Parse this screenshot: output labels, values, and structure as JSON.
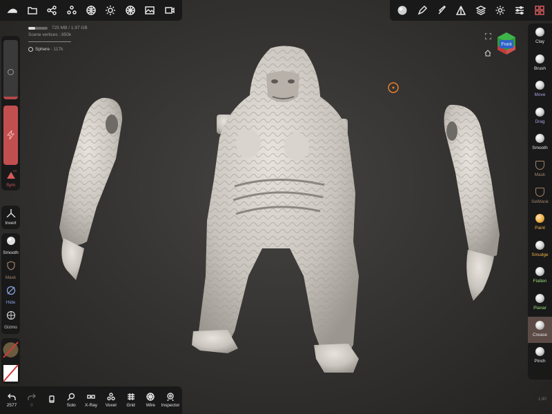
{
  "top_left_toolbar": {
    "icons": [
      "logo-icon",
      "folder-icon",
      "share-nodes-icon",
      "scene-objects-icon",
      "globe-icon",
      "sun-icon",
      "material-icon",
      "image-icon",
      "video-camera-icon"
    ]
  },
  "top_right_toolbar": {
    "icons": [
      "matcap-sphere-icon",
      "pen-icon",
      "brush-icon",
      "symmetry-triangle-icon",
      "layers-icon",
      "gear-icon",
      "sliders-icon",
      "grid-apps-icon"
    ]
  },
  "stats": {
    "memory": "725 MB / 1.97 GB",
    "memory_fraction": 0.37,
    "scene_vertices": "Scene vertices : 850k"
  },
  "object": {
    "name": "Sphere",
    "count": "- 117k"
  },
  "left_panel": {
    "radius_fill_fraction": 0.05,
    "sym_label": "Sym",
    "sym_small": "LR",
    "invert_label": "Invert",
    "tools": [
      {
        "label": "Smooth"
      },
      {
        "label": "Mask"
      },
      {
        "label": "Hide"
      },
      {
        "label": "Gizmo"
      }
    ]
  },
  "bottom_bar": {
    "items": [
      {
        "label": "2577",
        "icon": "undo-icon"
      },
      {
        "label": "0",
        "icon": "redo-icon"
      },
      {
        "label": "",
        "icon": "device-icon"
      },
      {
        "label": "Solo",
        "icon": "search-icon"
      },
      {
        "label": "X-Ray",
        "icon": "glasses-icon"
      },
      {
        "label": "Voxel",
        "icon": "voxel-icon"
      },
      {
        "label": "Grid",
        "icon": "grid-icon"
      },
      {
        "label": "Wire",
        "icon": "wire-icon"
      },
      {
        "label": "Inspector",
        "icon": "inspector-icon"
      }
    ]
  },
  "right_tools": [
    {
      "label": "Clay",
      "color": "#e6e6e6"
    },
    {
      "label": "Brush",
      "color": "#e6e6e6"
    },
    {
      "label": "Move",
      "color": "#a8a3e8"
    },
    {
      "label": "Drag",
      "color": "#a8a3e8"
    },
    {
      "label": "Smooth",
      "color": "#e6e6e6"
    },
    {
      "label": "Mask",
      "color": "#a1836b"
    },
    {
      "label": "SelMask",
      "color": "#a1836b"
    },
    {
      "label": "Paint",
      "color": "#f0b24a"
    },
    {
      "label": "Smudge",
      "color": "#f0b24a"
    },
    {
      "label": "Flatten",
      "color": "#9ee07a"
    },
    {
      "label": "Planar",
      "color": "#9ee07a"
    },
    {
      "label": "Crease",
      "color": "#e6e6e6"
    },
    {
      "label": "Pinch",
      "color": "#e6e6e6"
    }
  ],
  "view": {
    "cube_label": "Front"
  },
  "version": "1.90"
}
